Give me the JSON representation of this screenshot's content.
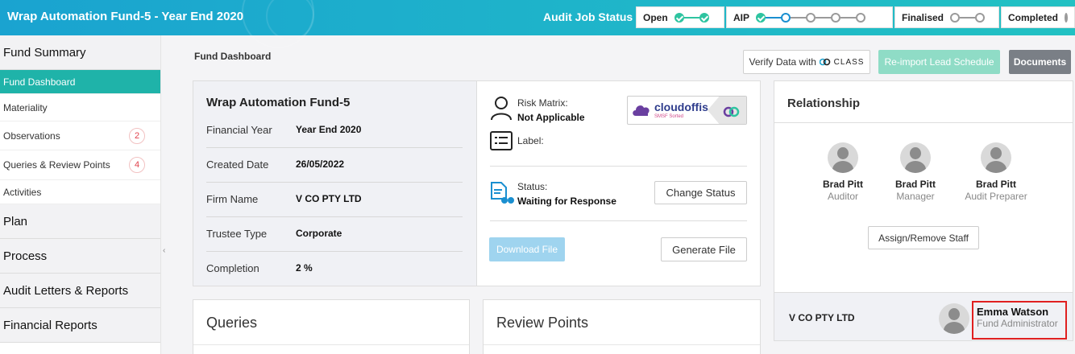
{
  "header": {
    "title": "Wrap Automation Fund-5 - Year End 2020",
    "audit_job_status_label": "Audit Job Status",
    "stages": [
      {
        "label": "Open"
      },
      {
        "label": "AIP"
      },
      {
        "label": "Finalised"
      },
      {
        "label": "Completed"
      }
    ],
    "colors": {
      "done": "#2ec4a0",
      "active": "#1a8fd0",
      "pending": "#9a9a9a"
    }
  },
  "sidebar": {
    "fund_summary": "Fund Summary",
    "items": [
      {
        "label": "Fund Dashboard",
        "active": true
      },
      {
        "label": "Materiality"
      },
      {
        "label": "Observations",
        "badge": "2"
      },
      {
        "label": "Queries & Review Points",
        "badge": "4"
      },
      {
        "label": "Activities"
      }
    ],
    "sections": [
      "Plan",
      "Process",
      "Audit Letters & Reports",
      "Financial Reports"
    ],
    "collapse_icon": "chevron-left-icon"
  },
  "page": {
    "title": "Fund Dashboard",
    "verify_label": "Verify Data with",
    "verify_logo": "CLASS",
    "reimport_label": "Re-import Lead Schedule",
    "documents_label": "Documents"
  },
  "fund": {
    "name": "Wrap Automation Fund-5",
    "rows": [
      {
        "key": "Financial Year",
        "value": "Year End 2020"
      },
      {
        "key": "Created Date",
        "value": "26/05/2022"
      },
      {
        "key": "Firm Name",
        "value": "V CO PTY LTD"
      },
      {
        "key": "Trustee Type",
        "value": "Corporate"
      },
      {
        "key": "Completion",
        "value": "2 %"
      }
    ],
    "risk_matrix_label": "Risk Matrix:",
    "risk_matrix_value": "Not Applicable",
    "label_label": "Label:",
    "status_label": "Status:",
    "status_value": "Waiting for Response",
    "change_status": "Change Status",
    "download_file": "Download File",
    "generate_file": "Generate File",
    "integration_logo": {
      "name": "cloudoffis",
      "tagline": "SMSF Sorted"
    }
  },
  "relationship": {
    "title": "Relationship",
    "people": [
      {
        "name": "Brad Pitt",
        "role": "Auditor"
      },
      {
        "name": "Brad Pitt",
        "role": "Manager"
      },
      {
        "name": "Brad Pitt",
        "role": "Audit Preparer"
      }
    ],
    "assign_label": "Assign/Remove Staff",
    "firm": "V CO PTY LTD",
    "admin_name": "Emma Watson",
    "admin_role": "Fund Administrator",
    "highlight_color": "#e02020"
  },
  "panels": {
    "queries": "Queries",
    "review_points": "Review Points"
  }
}
